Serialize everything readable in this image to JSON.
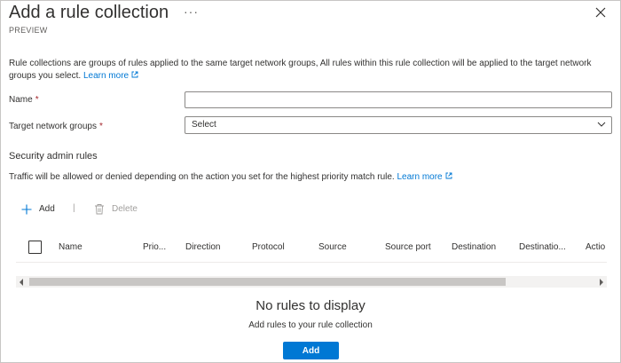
{
  "header": {
    "title": "Add a rule collection",
    "more_label": "···",
    "subtitle": "PREVIEW",
    "close_icon": "close-icon"
  },
  "description": {
    "text": "Rule collections are groups of rules applied to the same target network groups, All rules within this rule collection will be applied to the target network groups you select.",
    "link": "Learn more"
  },
  "form": {
    "name_label": "Name",
    "name_value": "",
    "required_mark": "*",
    "target_label": "Target network groups",
    "target_value": "Select"
  },
  "security": {
    "heading": "Security admin rules",
    "text": "Traffic will be allowed or denied depending on the action you set for the highest priority match rule.",
    "link": "Learn more"
  },
  "toolbar": {
    "add_label": "Add",
    "separator": "|",
    "delete_label": "Delete"
  },
  "table": {
    "columns": [
      "Name",
      "Prio...",
      "Direction",
      "Protocol",
      "Source",
      "Source port",
      "Destination",
      "Destinatio...",
      "Actio"
    ]
  },
  "empty": {
    "title": "No rules to display",
    "subtitle": "Add rules to your rule collection",
    "button": "Add"
  },
  "colors": {
    "accent": "#0078d4",
    "required": "#a4262c"
  }
}
